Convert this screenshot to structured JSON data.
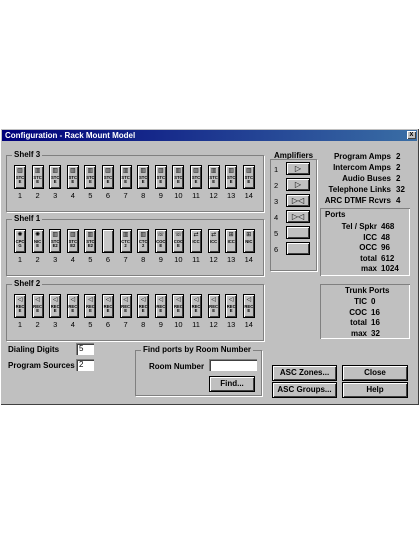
{
  "window": {
    "title": "Configuration - Rack Mount Model",
    "close_glyph": "x"
  },
  "shelves": [
    {
      "label": "Shelf 3",
      "slots": [
        {
          "icon": "rack-card-icon",
          "text": "STC\nE"
        },
        {
          "icon": "rack-card-icon",
          "text": "STC\nE"
        },
        {
          "icon": "rack-card-icon",
          "text": "STC\nE"
        },
        {
          "icon": "rack-card-icon",
          "text": "STC\nE"
        },
        {
          "icon": "rack-card-icon",
          "text": "STC\nE"
        },
        {
          "icon": "rack-card-icon",
          "text": "STC\nE"
        },
        {
          "icon": "rack-card-icon",
          "text": "STC\nE"
        },
        {
          "icon": "rack-card-icon",
          "text": "STC\nE"
        },
        {
          "icon": "rack-card-icon",
          "text": "STC\nE"
        },
        {
          "icon": "rack-card-icon",
          "text": "STC\nE"
        },
        {
          "icon": "rack-card-icon",
          "text": "STC\nE"
        },
        {
          "icon": "rack-card-icon",
          "text": "STC\nE"
        },
        {
          "icon": "rack-card-icon",
          "text": "STC\nE"
        },
        {
          "icon": "rack-card-icon",
          "text": "STC\nE"
        }
      ]
    },
    {
      "label": "Shelf 1",
      "slots": [
        {
          "icon": "sun-icon",
          "text": "CPC\nG"
        },
        {
          "icon": "sun-icon",
          "text": "NIC\nE"
        },
        {
          "icon": "rack-card-icon",
          "text": "STC\nE2"
        },
        {
          "icon": "rack-card-icon",
          "text": "STC\nE2"
        },
        {
          "icon": "rack-card-icon",
          "text": "STC\nE2"
        },
        {
          "icon": "",
          "text": ""
        },
        {
          "icon": "rack-card-icon",
          "text": "CTC\n2"
        },
        {
          "icon": "rack-card-icon",
          "text": "CTC\n2"
        },
        {
          "icon": "phone-icon",
          "text": "COC\nE"
        },
        {
          "icon": "phone-icon",
          "text": "COC\nE"
        },
        {
          "icon": "arrows-icon",
          "text": "ICC"
        },
        {
          "icon": "arrows-icon",
          "text": "ICC"
        },
        {
          "icon": "network-icon",
          "text": "ICC"
        },
        {
          "icon": "network-icon",
          "text": "NIC"
        }
      ]
    },
    {
      "label": "Shelf 2",
      "slots": [
        {
          "icon": "speaker-icon",
          "text": "REC\nE"
        },
        {
          "icon": "speaker-icon",
          "text": "REC\nE"
        },
        {
          "icon": "speaker-icon",
          "text": "REC\nE"
        },
        {
          "icon": "speaker-icon",
          "text": "REC\nE"
        },
        {
          "icon": "speaker-icon",
          "text": "REC\nE"
        },
        {
          "icon": "speaker-icon",
          "text": "REC\nE"
        },
        {
          "icon": "speaker-icon",
          "text": "REC\nE"
        },
        {
          "icon": "speaker-icon",
          "text": "REC\nE"
        },
        {
          "icon": "speaker-icon",
          "text": "REC\nE"
        },
        {
          "icon": "speaker-icon",
          "text": "REC\nE"
        },
        {
          "icon": "speaker-icon",
          "text": "REC\nE"
        },
        {
          "icon": "speaker-icon",
          "text": "REC\nE"
        },
        {
          "icon": "speaker-icon",
          "text": "REC\nE"
        },
        {
          "icon": "speaker-icon",
          "text": "REC\nE"
        }
      ]
    }
  ],
  "slot_numbers": [
    "1",
    "2",
    "3",
    "4",
    "5",
    "6",
    "7",
    "8",
    "9",
    "10",
    "11",
    "12",
    "13",
    "14"
  ],
  "amplifiers": {
    "label": "Amplifiers",
    "items": [
      {
        "num": "1",
        "glyph": "▷"
      },
      {
        "num": "2",
        "glyph": "▷"
      },
      {
        "num": "3",
        "glyph": "▷◁"
      },
      {
        "num": "4",
        "glyph": "▷◁"
      },
      {
        "num": "5",
        "glyph": ""
      },
      {
        "num": "6",
        "glyph": ""
      }
    ]
  },
  "summary": [
    {
      "label": "Program Amps",
      "value": "2"
    },
    {
      "label": "Intercom Amps",
      "value": "2"
    },
    {
      "label": "Audio Buses",
      "value": "2"
    },
    {
      "label": "Telephone Links",
      "value": "32"
    },
    {
      "label": "ARC DTMF Rcvrs",
      "value": "4"
    }
  ],
  "ports": {
    "title": "Ports",
    "rows": [
      {
        "label": "Tel / Spkr",
        "value": "468"
      },
      {
        "label": "ICC",
        "value": "48"
      },
      {
        "label": "OCC",
        "value": "96"
      },
      {
        "label": "total",
        "value": "612"
      },
      {
        "label": "max",
        "value": "1024"
      }
    ]
  },
  "trunk_ports": {
    "title": "Trunk  Ports",
    "rows": [
      {
        "label": "TIC",
        "value": "0"
      },
      {
        "label": "COC",
        "value": "16"
      },
      {
        "label": "total",
        "value": "16"
      },
      {
        "label": "max",
        "value": "32"
      }
    ]
  },
  "dialing_digits": {
    "label": "Dialing Digits",
    "value": "5"
  },
  "program_sources": {
    "label": "Program Sources",
    "value": "2"
  },
  "find_ports": {
    "title": "Find ports by Room Number",
    "room_label": "Room Number",
    "room_value": "",
    "find_button": "Find..."
  },
  "buttons": {
    "asc_zones": "ASC Zones...",
    "asc_groups": "ASC Groups...",
    "close": "Close",
    "help": "Help"
  }
}
